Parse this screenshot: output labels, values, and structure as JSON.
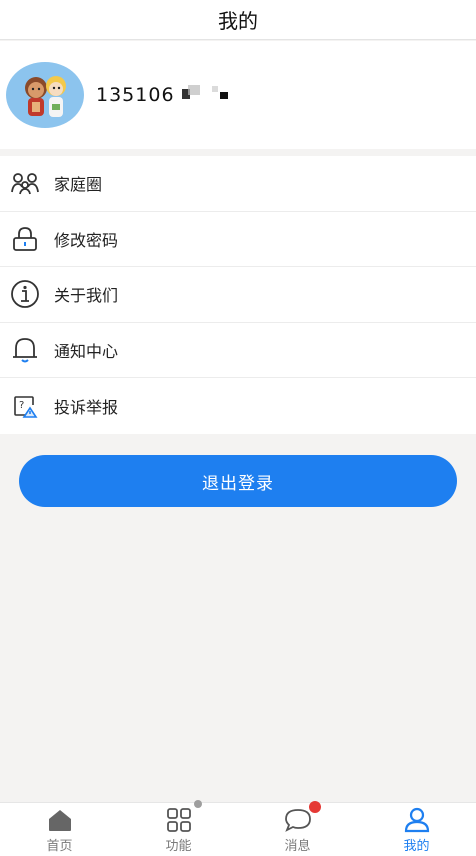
{
  "header": {
    "title": "我的"
  },
  "profile": {
    "phone": "135106"
  },
  "menu": {
    "items": [
      {
        "label": "家庭圈",
        "icon": "family-icon"
      },
      {
        "label": "修改密码",
        "icon": "lock-icon"
      },
      {
        "label": "关于我们",
        "icon": "info-icon"
      },
      {
        "label": "通知中心",
        "icon": "bell-icon"
      },
      {
        "label": "投诉举报",
        "icon": "report-icon"
      }
    ]
  },
  "logout": {
    "label": "退出登录"
  },
  "tabbar": {
    "items": [
      {
        "label": "首页",
        "icon": "home-icon",
        "active": false
      },
      {
        "label": "功能",
        "icon": "grid-icon",
        "active": false
      },
      {
        "label": "消息",
        "icon": "chat-icon",
        "active": false
      },
      {
        "label": "我的",
        "icon": "user-icon",
        "active": true
      }
    ]
  },
  "colors": {
    "accent": "#1e7ff0",
    "badge": "#e53935",
    "dot": "#9e9e9e"
  }
}
